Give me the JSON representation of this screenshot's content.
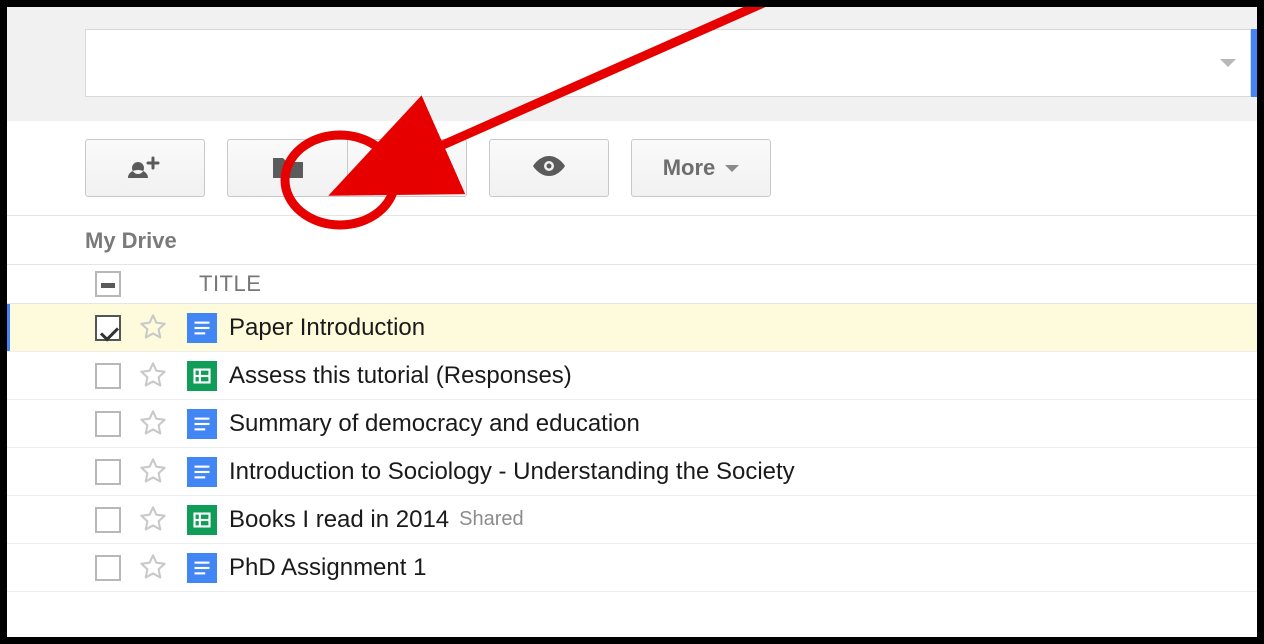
{
  "toolbar": {
    "more_label": "More"
  },
  "breadcrumb": "My Drive",
  "columns": {
    "title": "TITLE"
  },
  "rows": [
    {
      "title": "Paper Introduction",
      "type": "doc",
      "selected": true,
      "shared": false
    },
    {
      "title": "Assess this tutorial (Responses)",
      "type": "sheet",
      "selected": false,
      "shared": false
    },
    {
      "title": "Summary of democracy and education",
      "type": "doc",
      "selected": false,
      "shared": false
    },
    {
      "title": "Introduction to Sociology - Understanding the Society",
      "type": "doc",
      "selected": false,
      "shared": false
    },
    {
      "title": "Books I read in 2014",
      "type": "sheet",
      "selected": false,
      "shared": true
    },
    {
      "title": "PhD Assignment 1",
      "type": "doc",
      "selected": false,
      "shared": false
    }
  ],
  "shared_label": "Shared",
  "colors": {
    "doc": "#4285f4",
    "sheet": "#0f9d58",
    "annotation": "#e60000"
  }
}
